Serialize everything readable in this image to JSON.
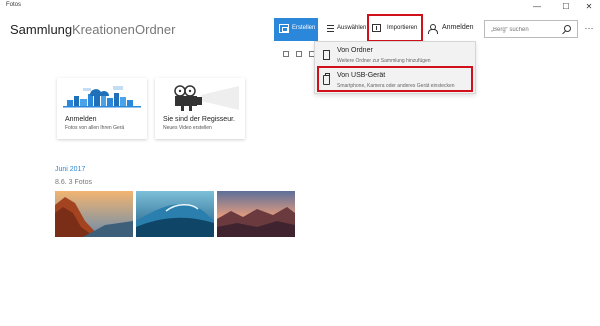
{
  "window": {
    "title": "Fotos",
    "minimize_glyph": "—",
    "maximize_glyph": "☐",
    "close_glyph": "✕"
  },
  "nav": {
    "items": [
      {
        "label": "Sammlung",
        "active": true
      },
      {
        "label": "Kreationen",
        "active": false
      },
      {
        "label": "Ordner",
        "active": false
      }
    ]
  },
  "toolbar": {
    "create_label": "Erstellen",
    "select_label": "Auswählen",
    "import_label": "Importieren",
    "signin_label": "Anmelden",
    "search_placeholder": "„Berg“ suchen",
    "more_glyph": "···",
    "create_color": "#2b87d9",
    "highlight_color": "#d0101a"
  },
  "import_menu": {
    "items": [
      {
        "icon": "folder-icon",
        "title": "Von Ordner",
        "subtitle": "Weitere Ordner zur Sammlung hinzufügen"
      },
      {
        "icon": "usb-icon",
        "title": "Von USB-Gerät",
        "subtitle": "Smartphone, Kamera oder anderes Gerät einstecken"
      }
    ]
  },
  "cards": [
    {
      "title": "Anmelden",
      "subtitle": "Fotos von allen Ihren Gerä",
      "icon": "onedrive-icon"
    },
    {
      "title": "Sie sind der Regisseur.",
      "subtitle": "Neues Video erstellen",
      "icon": "projector-icon"
    }
  ],
  "gallery": {
    "month": "Juni 2017",
    "day_count": "8.6.   3 Fotos",
    "photos": [
      {
        "alt": "El Capitan sunset"
      },
      {
        "alt": "Ocean wave"
      },
      {
        "alt": "Mountain dusk"
      }
    ]
  }
}
